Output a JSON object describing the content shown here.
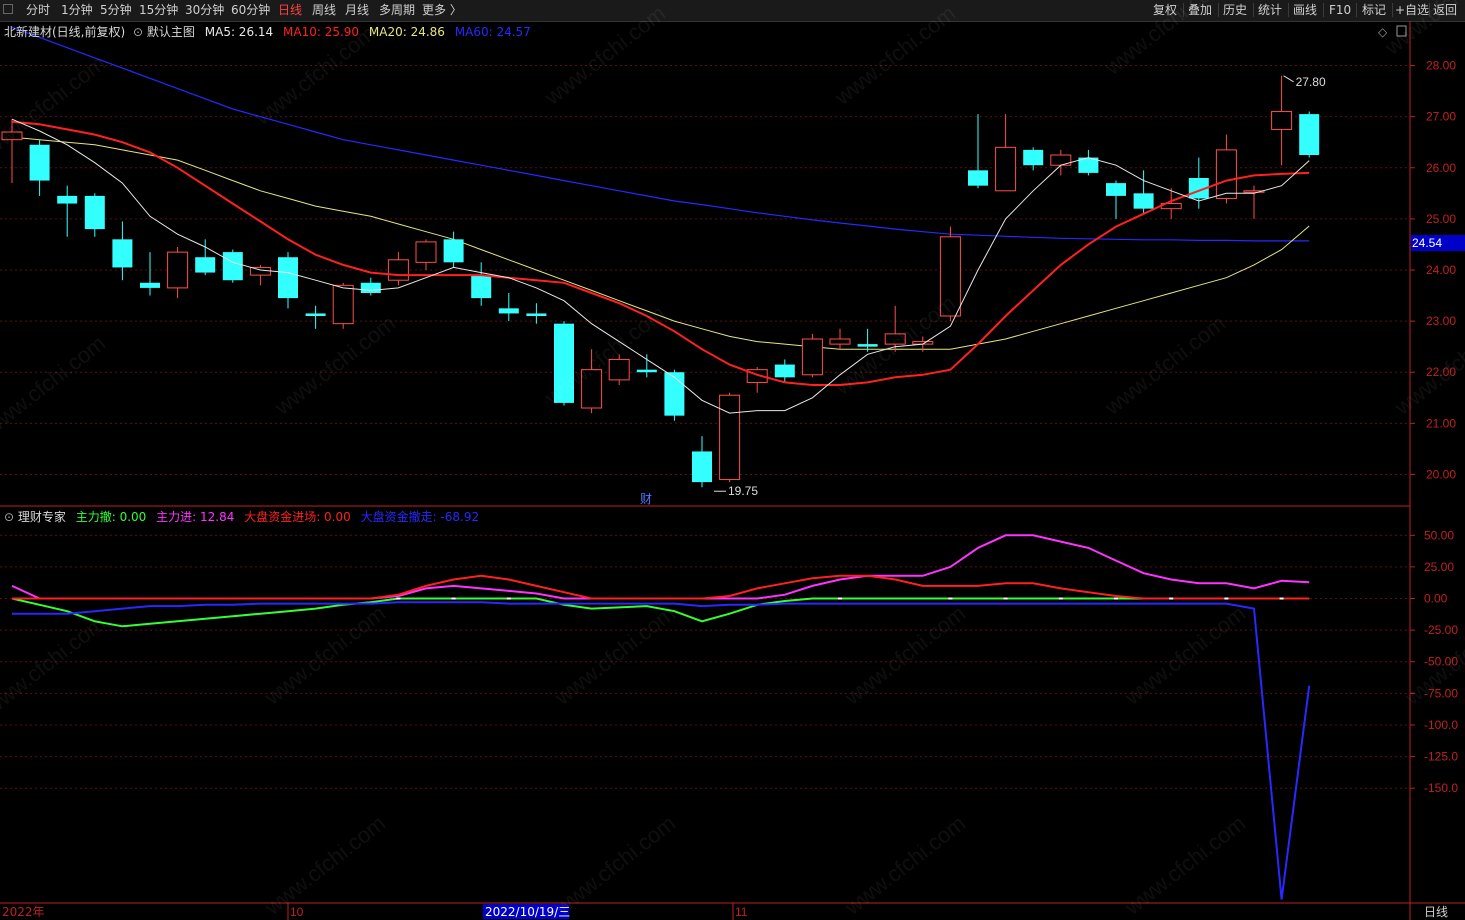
{
  "toolbar": {
    "periods": [
      "分时",
      "1分钟",
      "5分钟",
      "15分钟",
      "30分钟",
      "60分钟",
      "日线",
      "周线",
      "月线",
      "多周期",
      "更多 〉"
    ],
    "active_period": "日线",
    "tools": [
      "复权",
      "叠加",
      "历史",
      "统计",
      "画线",
      "F10",
      "标记",
      "+自选",
      "返回"
    ]
  },
  "main_legend": {
    "stock": "北新建材(日线,前复权)",
    "template": "默认主图",
    "ma5": "MA5: 26.14",
    "ma10": "MA10: 25.90",
    "ma20": "MA20: 24.86",
    "ma60": "MA60: 24.57"
  },
  "sub_legend": {
    "indicator": "理财专家",
    "zlc": "主力撤: 0.00",
    "zlj": "主力进: 12.84",
    "dpj": "大盘资金进场: 0.00",
    "dpc": "大盘资金撤走: -68.92"
  },
  "annotations": {
    "high": "27.80",
    "low": "19.75",
    "news": "财",
    "current_price": "24.54"
  },
  "bottom_axis": {
    "year": "2022年",
    "m10": "10",
    "date": "2022/10/19/三",
    "m11": "11",
    "period": "日线"
  },
  "watermark": "www.cfchi.com",
  "colors": {
    "up": "#ff4d4d",
    "down": "#33ffff",
    "ma5": "#e8e8e8",
    "ma10": "#ff2020",
    "ma20": "#e6e680",
    "ma60": "#2828ff",
    "zlc": "#33ff33",
    "zlj": "#ff33ff",
    "dpj": "#ff2020",
    "dpc": "#2828ff",
    "axis": "#c02020"
  },
  "chart_data": [
    {
      "type": "candlestick",
      "ylim": [
        19.5,
        28.5
      ],
      "yticks": [
        "20.00",
        "21.00",
        "22.00",
        "23.00",
        "24.00",
        "25.00",
        "26.00",
        "27.00",
        "28.00"
      ],
      "candles": [
        {
          "o": 26.55,
          "h": 26.95,
          "l": 25.7,
          "c": 26.7
        },
        {
          "o": 26.45,
          "h": 26.55,
          "l": 25.45,
          "c": 25.75
        },
        {
          "o": 25.45,
          "h": 25.65,
          "l": 24.65,
          "c": 25.3
        },
        {
          "o": 25.45,
          "h": 25.5,
          "l": 24.65,
          "c": 24.8
        },
        {
          "o": 24.6,
          "h": 24.95,
          "l": 23.8,
          "c": 24.05
        },
        {
          "o": 23.75,
          "h": 24.35,
          "l": 23.5,
          "c": 23.65
        },
        {
          "o": 23.65,
          "h": 24.45,
          "l": 23.45,
          "c": 24.35
        },
        {
          "o": 24.25,
          "h": 24.6,
          "l": 23.9,
          "c": 23.95
        },
        {
          "o": 24.35,
          "h": 24.4,
          "l": 23.75,
          "c": 23.8
        },
        {
          "o": 23.9,
          "h": 24.1,
          "l": 23.7,
          "c": 24.05
        },
        {
          "o": 24.25,
          "h": 24.35,
          "l": 23.25,
          "c": 23.45
        },
        {
          "o": 23.15,
          "h": 23.3,
          "l": 22.85,
          "c": 23.1
        },
        {
          "o": 22.95,
          "h": 23.75,
          "l": 22.85,
          "c": 23.7
        },
        {
          "o": 23.75,
          "h": 23.85,
          "l": 23.5,
          "c": 23.55
        },
        {
          "o": 23.8,
          "h": 24.35,
          "l": 23.7,
          "c": 24.2
        },
        {
          "o": 24.15,
          "h": 24.6,
          "l": 24.0,
          "c": 24.55
        },
        {
          "o": 24.6,
          "h": 24.75,
          "l": 24.05,
          "c": 24.15
        },
        {
          "o": 23.9,
          "h": 24.15,
          "l": 23.3,
          "c": 23.45
        },
        {
          "o": 23.25,
          "h": 23.55,
          "l": 23.0,
          "c": 23.15
        },
        {
          "o": 23.15,
          "h": 23.35,
          "l": 22.95,
          "c": 23.1
        },
        {
          "o": 22.95,
          "h": 23.0,
          "l": 21.35,
          "c": 21.4
        },
        {
          "o": 21.3,
          "h": 22.45,
          "l": 21.2,
          "c": 22.05
        },
        {
          "o": 21.85,
          "h": 22.35,
          "l": 21.75,
          "c": 22.25
        },
        {
          "o": 22.05,
          "h": 22.35,
          "l": 21.9,
          "c": 22.0
        },
        {
          "o": 22.0,
          "h": 22.05,
          "l": 21.05,
          "c": 21.15
        },
        {
          "o": 20.45,
          "h": 20.75,
          "l": 19.75,
          "c": 19.85
        },
        {
          "o": 19.9,
          "h": 21.6,
          "l": 19.85,
          "c": 21.55
        },
        {
          "o": 21.8,
          "h": 22.1,
          "l": 21.6,
          "c": 22.05
        },
        {
          "o": 22.15,
          "h": 22.25,
          "l": 21.8,
          "c": 21.9
        },
        {
          "o": 21.95,
          "h": 22.75,
          "l": 21.9,
          "c": 22.65
        },
        {
          "o": 22.55,
          "h": 22.85,
          "l": 22.45,
          "c": 22.65
        },
        {
          "o": 22.55,
          "h": 22.85,
          "l": 22.4,
          "c": 22.5
        },
        {
          "o": 22.55,
          "h": 23.3,
          "l": 22.4,
          "c": 22.75
        },
        {
          "o": 22.55,
          "h": 22.7,
          "l": 22.4,
          "c": 22.6
        },
        {
          "o": 23.1,
          "h": 24.85,
          "l": 23.0,
          "c": 24.65
        },
        {
          "o": 25.95,
          "h": 27.05,
          "l": 25.6,
          "c": 25.65
        },
        {
          "o": 25.55,
          "h": 27.05,
          "l": 25.55,
          "c": 26.4
        },
        {
          "o": 26.35,
          "h": 26.4,
          "l": 25.95,
          "c": 26.05
        },
        {
          "o": 26.05,
          "h": 26.35,
          "l": 25.85,
          "c": 26.25
        },
        {
          "o": 26.2,
          "h": 26.35,
          "l": 25.85,
          "c": 25.9
        },
        {
          "o": 25.7,
          "h": 25.75,
          "l": 25.0,
          "c": 25.45
        },
        {
          "o": 25.5,
          "h": 25.95,
          "l": 25.1,
          "c": 25.2
        },
        {
          "o": 25.2,
          "h": 25.6,
          "l": 25.0,
          "c": 25.3
        },
        {
          "o": 25.8,
          "h": 26.2,
          "l": 25.2,
          "c": 25.4
        },
        {
          "o": 25.4,
          "h": 26.65,
          "l": 25.3,
          "c": 26.35
        },
        {
          "o": 25.55,
          "h": 25.65,
          "l": 25.0,
          "c": 25.55
        },
        {
          "o": 26.75,
          "h": 27.8,
          "l": 26.05,
          "c": 27.1
        },
        {
          "o": 27.05,
          "h": 27.1,
          "l": 26.2,
          "c": 26.25
        }
      ],
      "ma5": [
        26.95,
        26.72,
        26.45,
        26.1,
        25.7,
        25.05,
        24.7,
        24.45,
        24.15,
        24.0,
        23.95,
        23.8,
        23.65,
        23.6,
        23.65,
        23.85,
        24.05,
        23.95,
        23.85,
        23.65,
        23.4,
        22.95,
        22.6,
        22.25,
        21.9,
        21.45,
        21.2,
        21.25,
        21.25,
        21.5,
        21.95,
        22.35,
        22.5,
        22.55,
        22.9,
        24.0,
        25.0,
        25.55,
        26.05,
        26.2,
        26.05,
        25.75,
        25.55,
        25.35,
        25.5,
        25.5,
        25.65,
        26.14
      ],
      "ma10": [
        26.9,
        26.85,
        26.75,
        26.65,
        26.5,
        26.3,
        26.0,
        25.65,
        25.3,
        24.95,
        24.6,
        24.3,
        24.1,
        23.95,
        23.9,
        23.9,
        23.9,
        23.9,
        23.85,
        23.8,
        23.75,
        23.55,
        23.35,
        23.1,
        22.8,
        22.45,
        22.15,
        21.95,
        21.8,
        21.75,
        21.75,
        21.8,
        21.9,
        21.95,
        22.05,
        22.55,
        23.1,
        23.6,
        24.1,
        24.5,
        24.85,
        25.1,
        25.35,
        25.55,
        25.75,
        25.85,
        25.88,
        25.9
      ],
      "ma20": [
        26.6,
        26.55,
        26.5,
        26.45,
        26.35,
        26.25,
        26.15,
        25.95,
        25.75,
        25.55,
        25.4,
        25.25,
        25.15,
        25.05,
        24.9,
        24.75,
        24.6,
        24.4,
        24.2,
        24.0,
        23.8,
        23.6,
        23.4,
        23.2,
        23.0,
        22.85,
        22.7,
        22.6,
        22.55,
        22.5,
        22.45,
        22.45,
        22.45,
        22.45,
        22.45,
        22.55,
        22.65,
        22.8,
        22.95,
        23.1,
        23.25,
        23.4,
        23.55,
        23.7,
        23.85,
        24.1,
        24.4,
        24.86
      ],
      "ma60": [
        28.75,
        28.55,
        28.35,
        28.15,
        27.95,
        27.75,
        27.55,
        27.35,
        27.15,
        27.0,
        26.85,
        26.7,
        26.55,
        26.45,
        26.35,
        26.25,
        26.15,
        26.05,
        25.95,
        25.85,
        25.75,
        25.65,
        25.55,
        25.45,
        25.35,
        25.28,
        25.2,
        25.12,
        25.05,
        24.98,
        24.92,
        24.86,
        24.8,
        24.75,
        24.7,
        24.68,
        24.66,
        24.64,
        24.62,
        24.61,
        24.6,
        24.59,
        24.59,
        24.58,
        24.58,
        24.57,
        24.57,
        24.57
      ]
    },
    {
      "type": "line",
      "title": "理财专家",
      "ylim": [
        -240,
        70
      ],
      "yticks": [
        "50.00",
        "25.00",
        "0.00",
        "-25.00",
        "-50.00",
        "-75.00",
        "-100.0",
        "-125.0",
        "-150.0"
      ],
      "series": [
        {
          "name": "主力撤",
          "values": [
            0,
            -5,
            -10,
            -18,
            -22,
            -20,
            -18,
            -16,
            -14,
            -12,
            -10,
            -8,
            -5,
            -3,
            0,
            0,
            0,
            0,
            0,
            0,
            -5,
            -8,
            -7,
            -6,
            -10,
            -18,
            -12,
            -5,
            -2,
            0,
            0,
            0,
            0,
            0,
            0,
            0,
            0,
            0,
            0,
            0,
            0,
            0,
            0,
            0,
            0,
            0,
            0,
            0
          ]
        },
        {
          "name": "主力进",
          "values": [
            10,
            0,
            0,
            0,
            0,
            0,
            0,
            0,
            0,
            0,
            0,
            0,
            0,
            0,
            2,
            8,
            10,
            8,
            6,
            4,
            0,
            0,
            0,
            0,
            0,
            0,
            0,
            0,
            3,
            10,
            15,
            18,
            18,
            18,
            25,
            40,
            50,
            50,
            45,
            40,
            30,
            20,
            15,
            12,
            12,
            8,
            14,
            12.84
          ]
        },
        {
          "name": "大盘资金进场",
          "values": [
            0,
            0,
            0,
            0,
            0,
            0,
            0,
            0,
            0,
            0,
            0,
            0,
            0,
            0,
            3,
            10,
            15,
            18,
            15,
            10,
            5,
            0,
            0,
            0,
            0,
            0,
            2,
            8,
            12,
            16,
            18,
            18,
            15,
            10,
            10,
            10,
            12,
            12,
            8,
            5,
            2,
            0,
            0,
            0,
            0,
            0,
            0,
            0
          ]
        },
        {
          "name": "大盘资金撤走",
          "values": [
            -12,
            -12,
            -12,
            -10,
            -8,
            -6,
            -6,
            -5,
            -5,
            -4,
            -4,
            -4,
            -4,
            -4,
            -3,
            -3,
            -3,
            -3,
            -4,
            -4,
            -4,
            -4,
            -4,
            -4,
            -4,
            -6,
            -5,
            -5,
            -4,
            -4,
            -4,
            -4,
            -4,
            -4,
            -4,
            -4,
            -4,
            -4,
            -4,
            -4,
            -4,
            -4,
            -4,
            -4,
            -4,
            -8,
            -238,
            -68.92
          ]
        }
      ]
    }
  ]
}
